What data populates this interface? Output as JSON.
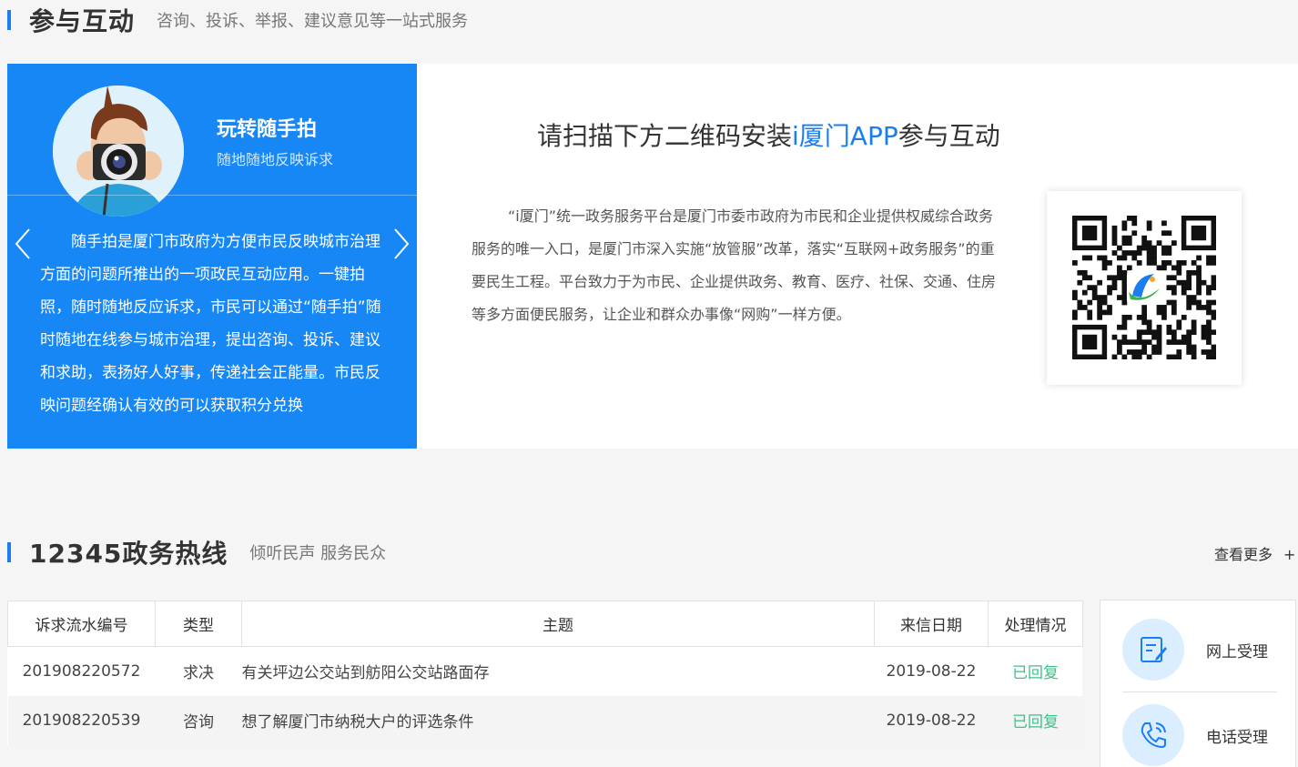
{
  "section1": {
    "title": "参与互动",
    "subtitle": "咨询、投诉、举报、建议意见等一站式服务"
  },
  "slide": {
    "title": "玩转随手拍",
    "subtitle": "随地随地反映诉求",
    "description": "随手拍是厦门市政府为方便市民反映城市治理方面的问题所推出的一项政民互动应用。一键拍照，随时随地反应诉求，市民可以通过“随手拍”随时随地在线参与城市治理，提出咨询、投诉、建议和求助，表扬好人好事，传递社会正能量。市民反映问题经确认有效的可以获取积分兑换"
  },
  "app": {
    "heading_prefix": "请扫描下方二维码安装",
    "heading_highlight": "i厦门APP",
    "heading_suffix": "参与互动",
    "description": "“i厦门”统一政务服务平台是厦门市委市政府为市民和企业提供权威综合政务服务的唯一入口，是厦门市深入实施“放管服”改革，落实“互联网+政务服务”的重要民生工程。平台致力于为市民、企业提供政务、教育、医疗、社保、交通、住房等多方面便民服务，让企业和群众办事像“网购”一样方便。"
  },
  "section2": {
    "title": "12345政务热线",
    "subtitle": "倾听民声 服务民众",
    "more": "查看更多",
    "more_icon": "+"
  },
  "table": {
    "headers": [
      "诉求流水编号",
      "类型",
      "主题",
      "来信日期",
      "处理情况"
    ],
    "rows": [
      [
        "201908220572",
        "求决",
        "有关坪边公交站到舫阳公交站路面存",
        "2019-08-22",
        "已回复"
      ],
      [
        "201908220539",
        "咨询",
        "想了解厦门市纳税大户的评选条件",
        "2019-08-22",
        "已回复"
      ]
    ]
  },
  "side": {
    "items": [
      {
        "label": "网上受理",
        "icon": "edit-form-icon"
      },
      {
        "label": "电话受理",
        "icon": "phone-icon"
      }
    ]
  },
  "colors": {
    "accent": "#1a7ef0",
    "slide_bg": "#1787f5",
    "status": "#3fc18a"
  }
}
